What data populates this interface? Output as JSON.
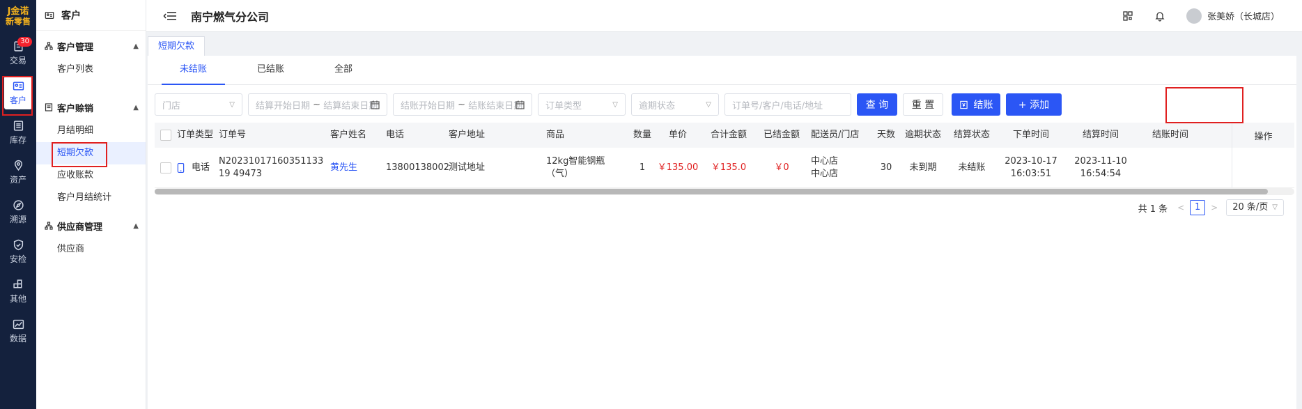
{
  "logo": {
    "line1": "J金诺",
    "line2": "新零售"
  },
  "rail": [
    {
      "label": "交易",
      "icon": "clipboard-icon",
      "badge": "30"
    },
    {
      "label": "客户",
      "icon": "id-card-icon",
      "active": true
    },
    {
      "label": "库存",
      "icon": "list-icon"
    },
    {
      "label": "资产",
      "icon": "location-icon"
    },
    {
      "label": "溯源",
      "icon": "compass-icon"
    },
    {
      "label": "安检",
      "icon": "shield-icon"
    },
    {
      "label": "其他",
      "icon": "grid-icon"
    },
    {
      "label": "数据",
      "icon": "chart-icon"
    }
  ],
  "subnav": {
    "header": "客户",
    "groups": [
      {
        "title": "客户管理",
        "items": [
          "客户列表"
        ]
      },
      {
        "title": "客户赊销",
        "items": [
          "月结明细",
          "短期欠款",
          "应收账款",
          "客户月结统计"
        ]
      },
      {
        "title": "供应商管理",
        "items": [
          "供应商"
        ]
      }
    ],
    "active_item": "短期欠款"
  },
  "topbar": {
    "title": "南宁燃气分公司",
    "user": "张美娇（长城店）"
  },
  "page_tab": "短期欠款",
  "subtabs": [
    "未结账",
    "已结账",
    "全部"
  ],
  "filters": {
    "store": "门店",
    "settle_start": "结算开始日期",
    "settle_end": "结算结束日期",
    "close_start": "结账开始日期",
    "close_end": "结账结束日期",
    "range_sep": "~",
    "order_type": "订单类型",
    "overdue": "逾期状态",
    "keyword": "订单号/客户/电话/地址",
    "query": "查 询",
    "reset": "重 置",
    "settle": "结账",
    "add": "+ 添加"
  },
  "table": {
    "headers": [
      "订单类型",
      "订单号",
      "客户姓名",
      "电话",
      "客户地址",
      "商品",
      "数量",
      "单价",
      "合计金额",
      "已结金额",
      "配送员/门店",
      "天数",
      "逾期状态",
      "结算状态",
      "下单时间",
      "结算时间",
      "结账时间",
      "操作"
    ],
    "rows": [
      {
        "order_type": "电话",
        "order_no": "N2023101716035113319 49473",
        "customer": "黄先生",
        "phone": "13800138002",
        "address": "测试地址",
        "goods": "12kg智能钢瓶（气）",
        "qty": "1",
        "price": "￥135.00",
        "total": "￥135.0",
        "paid": "￥0",
        "courier": "中心店",
        "store": "中心店",
        "days": "30",
        "overdue": "未到期",
        "settle_status": "未结账",
        "order_date": "2023-10-17",
        "order_time": "16:03:51",
        "settle_date": "2023-11-10",
        "settle_time": "16:54:54",
        "close_time": ""
      }
    ]
  },
  "pager": {
    "total": "共 1 条",
    "page": "1",
    "size": "20 条/页"
  },
  "colors": {
    "accent": "#2b56f5",
    "rail": "#14213d",
    "highlight": "#e02020",
    "money": "#e02020"
  }
}
